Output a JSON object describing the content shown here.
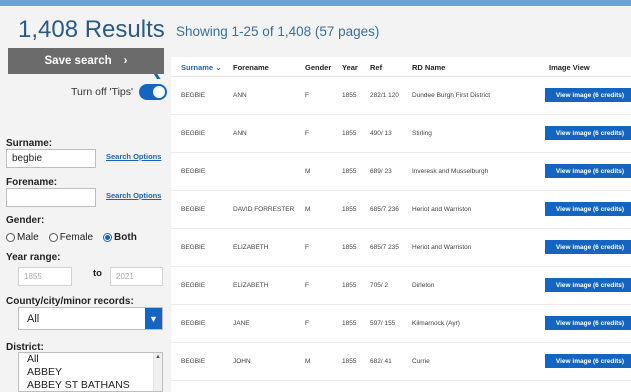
{
  "header": {
    "results_title": "1,408 Results",
    "showing": "Showing 1-25 of 1,408 (57 pages)"
  },
  "sidebar": {
    "collapse_icon": "chevron-left-icon",
    "tips_label": "Turn off 'Tips'",
    "save_search_label": "Save search",
    "surname_label": "Surname:",
    "surname_value": "begbie",
    "search_options": "Search Options",
    "forename_label": "Forename:",
    "forename_value": "",
    "gender_label": "Gender:",
    "gender_options": [
      "Male",
      "Female",
      "Both"
    ],
    "gender_selected": "Both",
    "year_range_label": "Year range:",
    "year_from_placeholder": "1855",
    "year_to_label": "to",
    "year_to_placeholder": "2021",
    "county_label": "County/city/minor records:",
    "county_value": "All",
    "district_label": "District:",
    "district_items": [
      "All",
      "ABBEY",
      "ABBEY ST BATHANS"
    ]
  },
  "table": {
    "headers": {
      "surname": "Surname",
      "forename": "Forename",
      "gender": "Gender",
      "year": "Year",
      "ref": "Ref",
      "rd_name": "RD Name",
      "image_view": "Image View"
    },
    "view_label": "View image (6 credits)",
    "rows": [
      {
        "surname": "BEGBIE",
        "forename": "ANN",
        "gender": "F",
        "year": "1855",
        "ref": "282/1 120",
        "rd_name": "Dundee Burgh First District"
      },
      {
        "surname": "BEGBIE",
        "forename": "ANN",
        "gender": "F",
        "year": "1855",
        "ref": "490/ 13",
        "rd_name": "Stirling"
      },
      {
        "surname": "BEGBIE",
        "forename": "",
        "gender": "M",
        "year": "1855",
        "ref": "689/ 23",
        "rd_name": "Inveresk and Musselburgh"
      },
      {
        "surname": "BEGBIE",
        "forename": "DAVID FORRESTER",
        "gender": "M",
        "year": "1855",
        "ref": "685/7 236",
        "rd_name": "Heriot and Warriston"
      },
      {
        "surname": "BEGBIE",
        "forename": "ELIZABETH",
        "gender": "F",
        "year": "1855",
        "ref": "685/7 235",
        "rd_name": "Heriot and Warriston"
      },
      {
        "surname": "BEGBIE",
        "forename": "ELIZABETH",
        "gender": "F",
        "year": "1855",
        "ref": "705/ 2",
        "rd_name": "Dirleton"
      },
      {
        "surname": "BEGBIE",
        "forename": "JANE",
        "gender": "F",
        "year": "1855",
        "ref": "597/ 155",
        "rd_name": "Kilmarnock (Ayr)"
      },
      {
        "surname": "BEGBIE",
        "forename": "JOHN",
        "gender": "M",
        "year": "1855",
        "ref": "682/ 41",
        "rd_name": "Currie"
      }
    ]
  }
}
